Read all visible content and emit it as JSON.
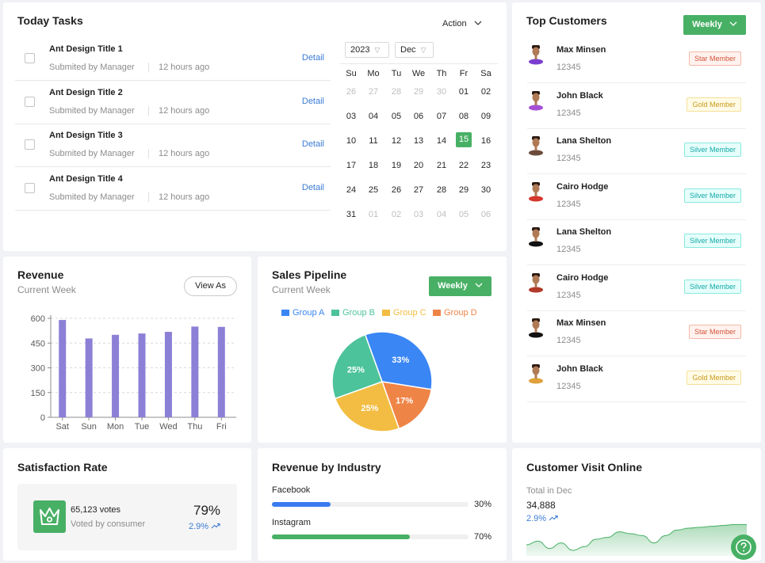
{
  "today_tasks": {
    "title": "Today Tasks",
    "action_label": "Action",
    "tasks": [
      {
        "title": "Ant Design Title 1",
        "submitted": "Submited by Manager",
        "time": "12 hours ago",
        "link": "Detail"
      },
      {
        "title": "Ant Design Title 2",
        "submitted": "Submited by Manager",
        "time": "12 hours ago",
        "link": "Detail"
      },
      {
        "title": "Ant Design Title 3",
        "submitted": "Submited by Manager",
        "time": "12 hours ago",
        "link": "Detail"
      },
      {
        "title": "Ant Design Title 4",
        "submitted": "Submited by Manager",
        "time": "12 hours ago",
        "link": "Detail"
      }
    ],
    "calendar": {
      "year": "2023",
      "month": "Dec",
      "weekdays": [
        "Su",
        "Mo",
        "Tu",
        "We",
        "Th",
        "Fr",
        "Sa"
      ],
      "weeks": [
        [
          "26",
          "27",
          "28",
          "29",
          "30",
          "01",
          "02"
        ],
        [
          "03",
          "04",
          "05",
          "06",
          "07",
          "08",
          "09"
        ],
        [
          "10",
          "11",
          "12",
          "13",
          "14",
          "15",
          "16"
        ],
        [
          "17",
          "18",
          "19",
          "20",
          "21",
          "22",
          "23"
        ],
        [
          "24",
          "25",
          "26",
          "27",
          "28",
          "29",
          "30"
        ],
        [
          "31",
          "01",
          "02",
          "03",
          "04",
          "05",
          "06"
        ]
      ],
      "selected": "15"
    }
  },
  "top_customers": {
    "title": "Top Customers",
    "period_button": "Weekly",
    "customers": [
      {
        "name": "Max Minsen",
        "id": "12345",
        "badge": "Star Member",
        "tier": "star",
        "color": "#7a3fd1"
      },
      {
        "name": "John Black",
        "id": "12345",
        "badge": "Gold Member",
        "tier": "gold",
        "color": "#a64fd6"
      },
      {
        "name": "Lana Shelton",
        "id": "12345",
        "badge": "Silver Member",
        "tier": "silver",
        "color": "#6b4b3a"
      },
      {
        "name": "Cairo Hodge",
        "id": "12345",
        "badge": "Silver Member",
        "tier": "silver",
        "color": "#d4382c"
      },
      {
        "name": "Lana Shelton",
        "id": "12345",
        "badge": "Silver Member",
        "tier": "silver",
        "color": "#111111"
      },
      {
        "name": "Cairo Hodge",
        "id": "12345",
        "badge": "Silver Member",
        "tier": "silver",
        "color": "#b23a2a"
      },
      {
        "name": "Max Minsen",
        "id": "12345",
        "badge": "Star Member",
        "tier": "star",
        "color": "#111111"
      },
      {
        "name": "John Black",
        "id": "12345",
        "badge": "Gold Member",
        "tier": "gold",
        "color": "#e0a03a"
      }
    ]
  },
  "revenue": {
    "title": "Revenue",
    "subtitle": "Current Week",
    "button": "View As"
  },
  "sales_pipeline": {
    "title": "Sales Pipeline",
    "subtitle": "Current Week",
    "period_button": "Weekly"
  },
  "satisfaction": {
    "title": "Satisfaction Rate",
    "votes": "65,123 votes",
    "votes_caption": "Voted by consumer",
    "rate": "79%",
    "change": "2.9%"
  },
  "revenue_by_industry": {
    "title": "Revenue by Industry",
    "items": [
      {
        "label": "Facebook",
        "value": "30%",
        "fraction": 0.3,
        "color": "#3a7bf0"
      },
      {
        "label": "Instagram",
        "value": "70%",
        "fraction": 0.7,
        "color": "#48b065"
      }
    ]
  },
  "customer_visit": {
    "title": "Customer Visit Online",
    "caption": "Total in Dec",
    "total": "34,888",
    "change": "2.9%"
  },
  "colors": {
    "accent_green": "#48b065",
    "link_blue": "#3a7bd5",
    "bar_purple": "#8b80d6"
  },
  "chart_data": [
    {
      "type": "bar",
      "categories": [
        "Sat",
        "Sun",
        "Mon",
        "Tue",
        "Wed",
        "Thu",
        "Fri"
      ],
      "values": [
        590,
        478,
        500,
        508,
        518,
        550,
        548
      ],
      "ylim": [
        0,
        600
      ],
      "yticks": [
        "0",
        "150",
        "300",
        "450",
        "600"
      ],
      "grid": true
    },
    {
      "type": "pie",
      "labels": [
        "Group A",
        "Group B",
        "Group C",
        "Group D"
      ],
      "values": [
        33,
        25,
        25,
        17
      ],
      "data_labels": [
        "33%",
        "25%",
        "25%",
        "17%"
      ],
      "colors": [
        "#3a86f5",
        "#4cc39a",
        "#f2bd42",
        "#ef8447"
      ],
      "legend": "top"
    },
    {
      "type": "area",
      "values": [
        12,
        16,
        8,
        14,
        6,
        10,
        18,
        20,
        26,
        24,
        22,
        14,
        22,
        28,
        30,
        31,
        32,
        33,
        34,
        34
      ],
      "color": "#48b065"
    }
  ]
}
